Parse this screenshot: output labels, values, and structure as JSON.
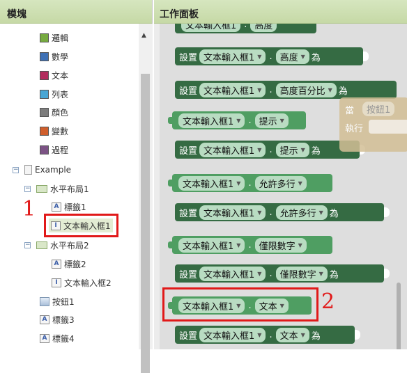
{
  "left": {
    "title": "模塊",
    "categories": [
      {
        "label": "邏輯",
        "color": "#77ab41"
      },
      {
        "label": "數學",
        "color": "#3f71b5"
      },
      {
        "label": "文本",
        "color": "#b32d5e"
      },
      {
        "label": "列表",
        "color": "#49a6d4"
      },
      {
        "label": "顏色",
        "color": "#7d7d7d"
      },
      {
        "label": "變數",
        "color": "#d05f2d"
      },
      {
        "label": "過程",
        "color": "#7c5385"
      }
    ],
    "tree": {
      "root": "Example",
      "h1": "水平布局1",
      "h1_label": "標籤1",
      "h1_textbox": "文本輸入框1",
      "h2": "水平布局2",
      "h2_label": "標籤2",
      "h2_textbox": "文本輸入框2",
      "button": "按鈕1",
      "label3": "標籤3",
      "label4": "標籤4"
    },
    "annotation": "1"
  },
  "right": {
    "title": "工作面板",
    "set_label": "設置",
    "as_label": "為",
    "component": "文本輸入框1",
    "props": {
      "height": "高度",
      "height_pct": "高度百分比",
      "hint": "提示",
      "multiline": "允許多行",
      "numbers_only": "僅限數字",
      "text": "文本"
    },
    "annotation": "2",
    "ghost": {
      "when": "當",
      "button": "按鈕1",
      "do": "執行"
    }
  }
}
